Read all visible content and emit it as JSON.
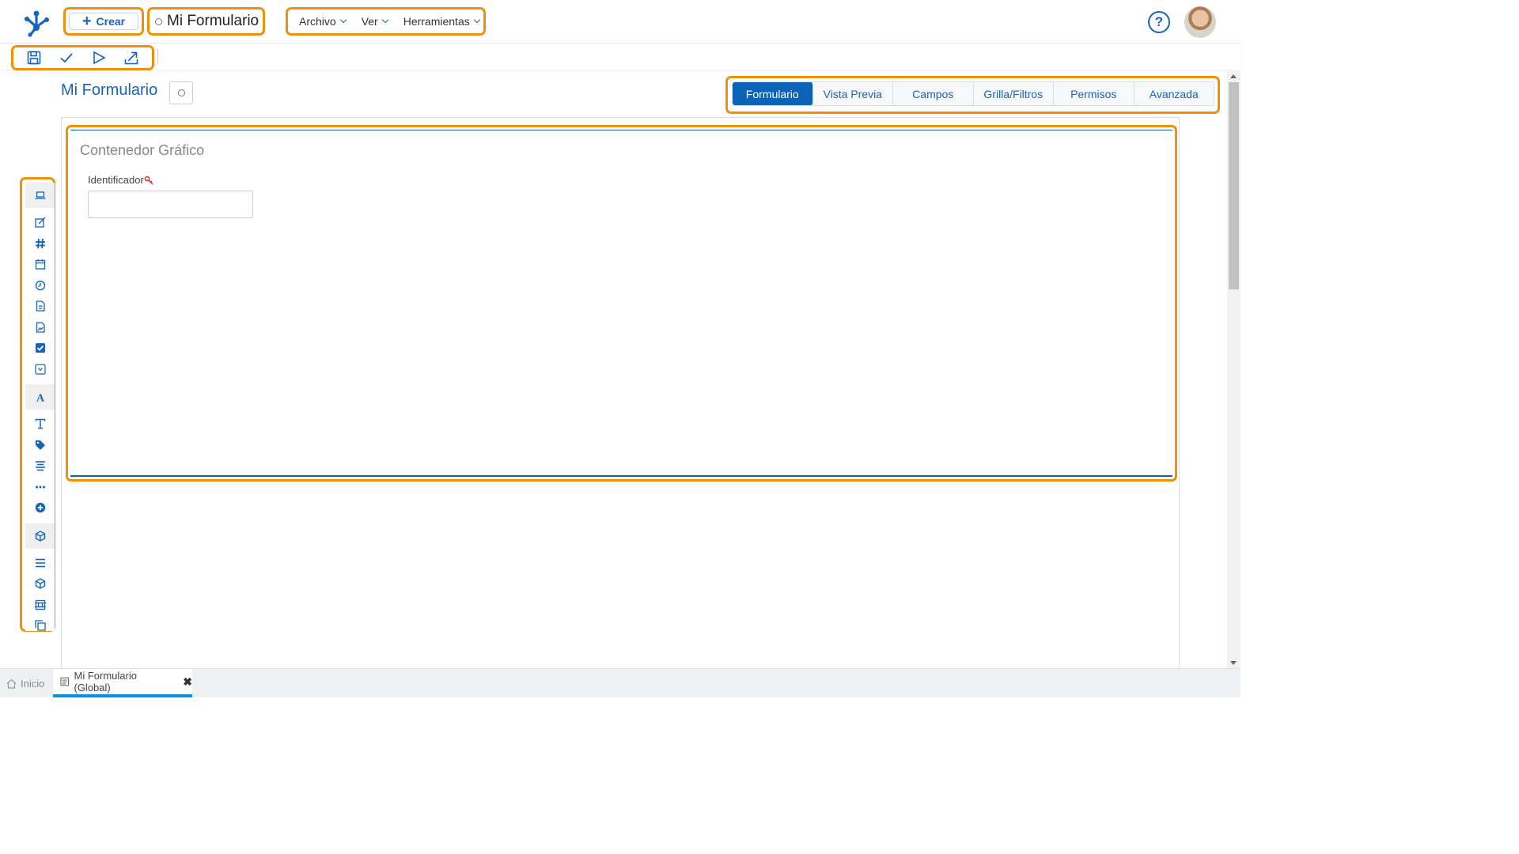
{
  "header": {
    "create_label": "Crear",
    "app_title": "Mi Formulario",
    "menus": [
      {
        "label": "Archivo"
      },
      {
        "label": "Ver"
      },
      {
        "label": "Herramientas"
      }
    ],
    "help_symbol": "?"
  },
  "toolbar": {
    "icons": [
      "save-icon",
      "check-icon",
      "play-icon",
      "export-icon"
    ]
  },
  "page": {
    "title": "Mi Formulario"
  },
  "tabs": [
    {
      "label": "Formulario",
      "active": true
    },
    {
      "label": "Vista Previa",
      "active": false
    },
    {
      "label": "Campos",
      "active": false
    },
    {
      "label": "Grilla/Filtros",
      "active": false
    },
    {
      "label": "Permisos",
      "active": false
    },
    {
      "label": "Avanzada",
      "active": false
    }
  ],
  "container": {
    "title": "Contenedor Gráfico",
    "field_label": "Identificador",
    "field_value": ""
  },
  "palette": {
    "icons": [
      "laptop-icon",
      "edit-icon",
      "hash-icon",
      "calendar-icon",
      "clock-icon",
      "file-icon",
      "image-icon",
      "checkbox-icon",
      "dropdown-icon",
      "font-icon",
      "text-icon",
      "tags-icon",
      "align-icon",
      "ellipsis-icon",
      "plus-circle-icon",
      "cube-icon",
      "list-icon",
      "cube-small-icon",
      "frame-icon",
      "copy-icon"
    ]
  },
  "bottom_tabs": {
    "home_label": "Inicio",
    "form_label": "Mi Formulario (Global)",
    "close_symbol": "✖"
  },
  "colors": {
    "accent": "#0a63b5",
    "highlight": "#f0900a"
  }
}
